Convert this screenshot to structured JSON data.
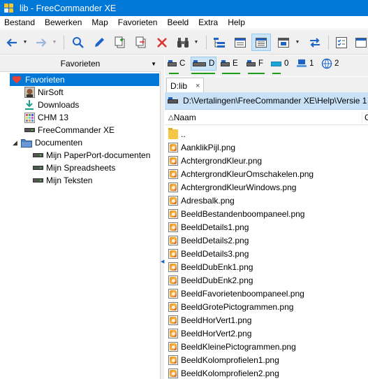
{
  "window": {
    "title": "lib - FreeCommander XE"
  },
  "menu": [
    "Bestand",
    "Bewerken",
    "Map",
    "Favorieten",
    "Beeld",
    "Extra",
    "Help"
  ],
  "toolbar": {
    "icons": [
      "back-arrow-icon",
      "forward-arrow-icon",
      "search-icon",
      "pencil-icon",
      "copy-icon",
      "move-icon",
      "delete-icon",
      "binoculars-icon",
      "tree-view-icon",
      "details-view-icon",
      "list-view-icon",
      "thumbnail-view-icon",
      "sync-icon",
      "checklist-icon",
      "window-icon"
    ]
  },
  "favorites_panel": {
    "header": "Favorieten",
    "tree": [
      {
        "label": "Favorieten",
        "icon": "heart-icon",
        "selected": true
      },
      {
        "label": "NirSoft",
        "icon": "avatar-icon"
      },
      {
        "label": "Downloads",
        "icon": "download-icon"
      },
      {
        "label": "CHM 13",
        "icon": "grid-icon"
      },
      {
        "label": "FreeCommander XE",
        "icon": "drive-icon"
      },
      {
        "label": "Documenten",
        "icon": "folder-icon"
      },
      {
        "label": "Mijn PaperPort-documenten",
        "icon": "drive-icon"
      },
      {
        "label": "Mijn Spreadsheets",
        "icon": "drive-icon"
      },
      {
        "label": "Mijn Teksten",
        "icon": "drive-icon"
      }
    ]
  },
  "drives": [
    {
      "letter": "C",
      "active": false
    },
    {
      "letter": "D",
      "active": true
    },
    {
      "letter": "E",
      "active": false
    },
    {
      "letter": "F",
      "active": false
    },
    {
      "letter": "0",
      "active": false
    },
    {
      "letter": "1",
      "active": false
    },
    {
      "letter": "2",
      "active": false
    }
  ],
  "tab": {
    "label": "D:lib",
    "close": "×"
  },
  "path": "D:\\Vertalingen\\FreeCommander XE\\Help\\Versie 1",
  "columns": {
    "name": "Naam",
    "sort_indicator": "△",
    "next": "G"
  },
  "files": [
    "..",
    "AanklikPijl.png",
    "AchtergrondKleur.png",
    "AchtergrondKleurOmschakelen.png",
    "AchtergrondKleurWindows.png",
    "Adresbalk.png",
    "BeeldBestandenboompaneel.png",
    "BeeldDetails1.png",
    "BeeldDetails2.png",
    "BeeldDetails3.png",
    "BeeldDubEnk1.png",
    "BeeldDubEnk2.png",
    "BeeldFavorietenboompaneel.png",
    "BeeldGrotePictogrammen.png",
    "BeeldHorVert1.png",
    "BeeldHorVert2.png",
    "BeeldKleinePictogrammen.png",
    "BeeldKolomprofielen1.png",
    "BeeldKolomprofielen2.png"
  ]
}
